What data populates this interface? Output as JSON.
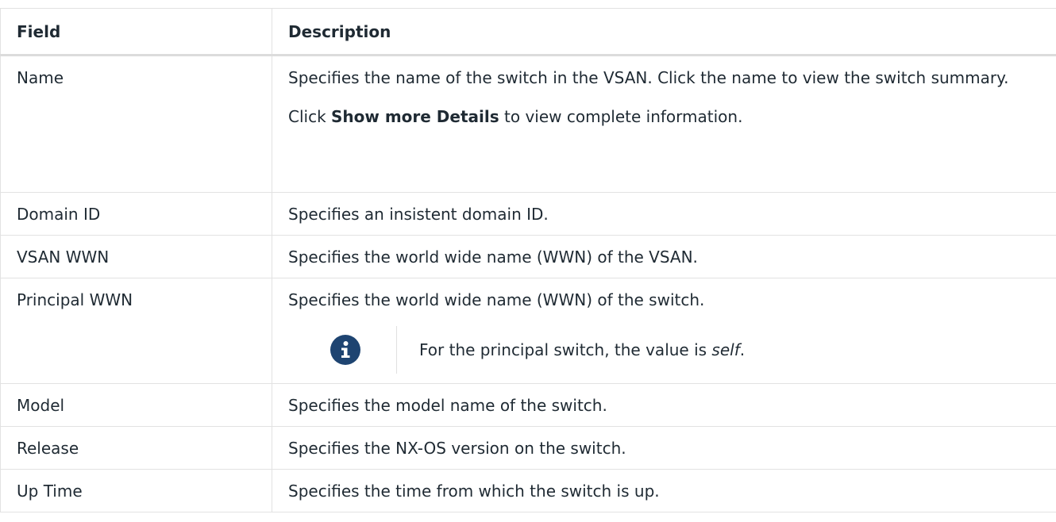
{
  "table": {
    "headers": {
      "field": "Field",
      "description": "Description"
    },
    "rows": [
      {
        "field": "Name",
        "description": "Specifies the name of the switch in the VSAN. Click the name to view the switch summary.",
        "extra_prefix": "Click ",
        "extra_bold": "Show more Details",
        "extra_suffix": " to view complete information."
      },
      {
        "field": "Domain ID",
        "description": "Specifies an insistent domain ID."
      },
      {
        "field": "VSAN WWN",
        "description": "Specifies the world wide name (WWN) of the VSAN."
      },
      {
        "field": "Principal WWN",
        "description": "Specifies the world wide name (WWN) of the switch.",
        "note_icon": "info-icon",
        "note_prefix": "For the principal switch, the value is ",
        "note_italic": "self",
        "note_suffix": "."
      },
      {
        "field": "Model",
        "description": "Specifies the model name of the switch."
      },
      {
        "field": "Release",
        "description": "Specifies the NX-OS version on the switch."
      },
      {
        "field": "Up Time",
        "description": "Specifies the time from which the switch is up."
      }
    ]
  }
}
